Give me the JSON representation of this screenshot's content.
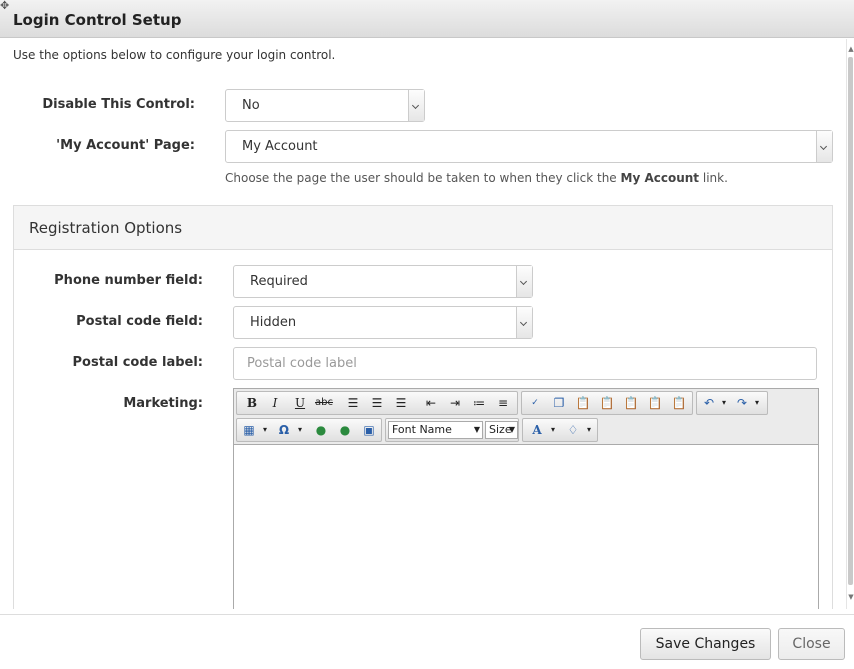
{
  "dialog": {
    "title": "Login Control Setup"
  },
  "intro": "Use the options below to configure your login control.",
  "disable_control": {
    "label": "Disable This Control:",
    "value": "No"
  },
  "my_account": {
    "label": "'My Account' Page:",
    "value": "My Account",
    "help_prefix": "Choose the page the user should be taken to when they click the",
    "help_bold": "My Account",
    "help_suffix": "link."
  },
  "registration": {
    "title": "Registration Options",
    "phone": {
      "label": "Phone number field:",
      "value": "Required"
    },
    "postal": {
      "label": "Postal code field:",
      "value": "Hidden"
    },
    "postal_label": {
      "label": "Postal code label:",
      "placeholder": "Postal code label"
    },
    "marketing": {
      "label": "Marketing:",
      "toolbar": {
        "font_name": "Font Name",
        "font_size": "Size"
      }
    }
  },
  "footer": {
    "save_label": "Save Changes",
    "close_label": "Close"
  }
}
